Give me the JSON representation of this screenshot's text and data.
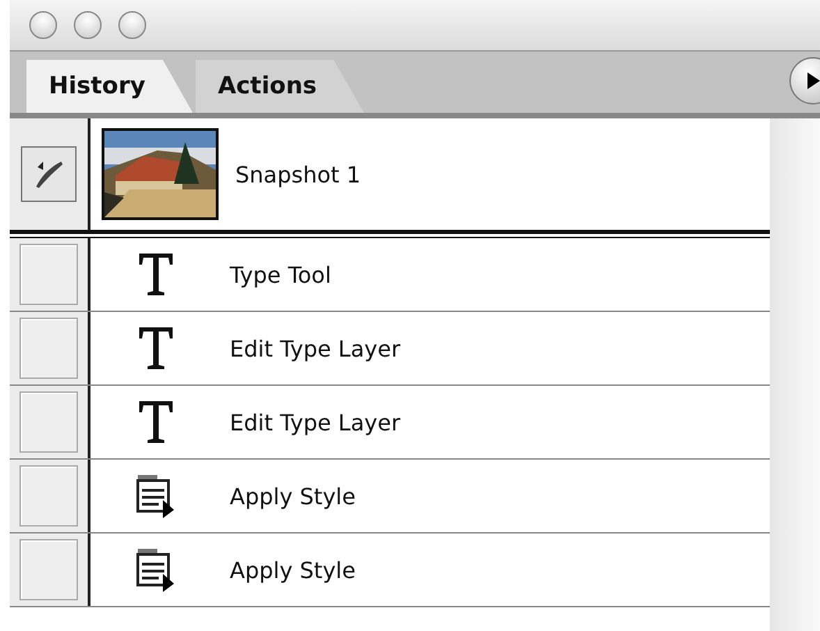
{
  "tabs": [
    {
      "label": "History",
      "selected": true
    },
    {
      "label": "Actions",
      "selected": false
    }
  ],
  "snapshot": {
    "label": "Snapshot 1",
    "kind": "picture"
  },
  "history": [
    {
      "kind": "type",
      "label": "Type Tool",
      "source": false
    },
    {
      "kind": "type",
      "label": "Edit Type Layer",
      "source": false
    },
    {
      "kind": "type",
      "label": "Edit Type Layer",
      "source": false
    },
    {
      "kind": "style",
      "label": "Apply Style",
      "source": false
    },
    {
      "kind": "style",
      "label": "Apply Style",
      "source": false
    }
  ]
}
